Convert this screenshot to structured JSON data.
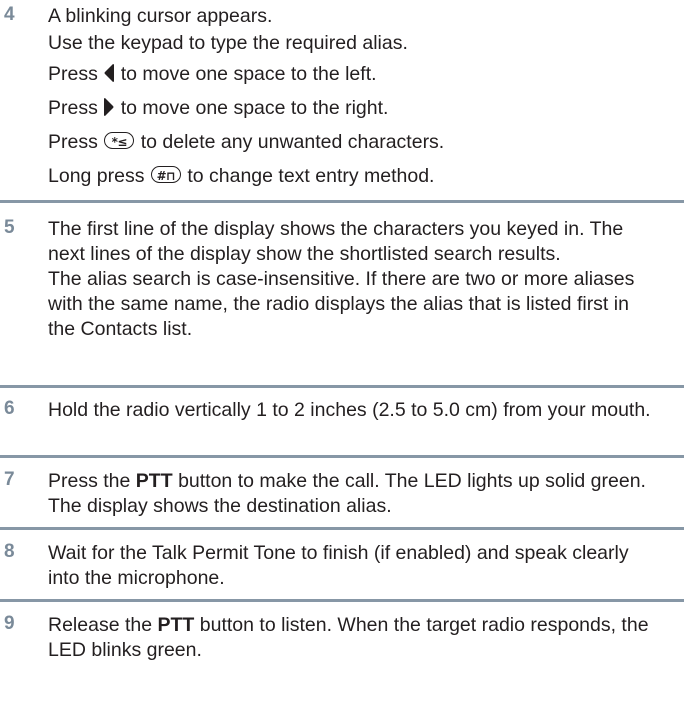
{
  "steps": [
    {
      "number": "4",
      "lines": {
        "l1": "A blinking cursor appears.",
        "l2": "Use the keypad to type the required alias.",
        "l3_a": "Press",
        "l3_b": "to move one space to the left.",
        "l4_a": "Press",
        "l4_b": "to move one space to the right.",
        "l5_a": "Press",
        "l5_b": "to delete any unwanted characters.",
        "l6_a": "Long press",
        "l6_b": "to change text entry method."
      },
      "icons": {
        "left_arrow": "left-arrow-icon",
        "right_arrow": "right-arrow-icon",
        "star_key": "*≤",
        "hash_key": "#⊓"
      }
    },
    {
      "number": "5",
      "p1": "The first line of the display shows the characters you keyed in. The next lines of the display show the shortlisted search results.",
      "p2": "The alias search is case-insensitive. If there are two or more aliases with the same name, the radio displays the alias that is listed first in the Contacts list."
    },
    {
      "number": "6",
      "p1": "Hold the radio vertically 1 to 2 inches (2.5 to 5.0 cm) from your mouth."
    },
    {
      "number": "7",
      "pre": "Press the",
      "bold": "PTT",
      "post": "button to make the call. The LED lights up solid green. The display shows the destination alias."
    },
    {
      "number": "8",
      "p1": "Wait for the Talk Permit Tone to finish (if enabled) and speak clearly into the microphone."
    },
    {
      "number": "9",
      "pre": "Release the",
      "bold": "PTT",
      "post": "button to listen. When the target radio responds, the LED blinks green."
    }
  ],
  "colors": {
    "step_number": "#7a8a99",
    "divider": "#8797a6",
    "text": "#231f20"
  }
}
